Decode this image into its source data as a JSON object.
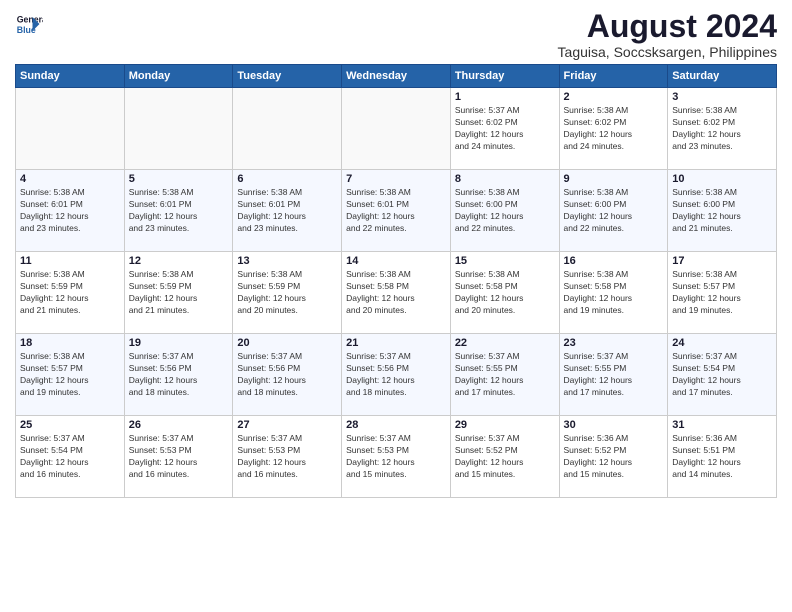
{
  "logo": {
    "line1": "General",
    "line2": "Blue"
  },
  "title": "August 2024",
  "location": "Taguisa, Soccsksargen, Philippines",
  "days_of_week": [
    "Sunday",
    "Monday",
    "Tuesday",
    "Wednesday",
    "Thursday",
    "Friday",
    "Saturday"
  ],
  "weeks": [
    [
      {
        "day": "",
        "info": ""
      },
      {
        "day": "",
        "info": ""
      },
      {
        "day": "",
        "info": ""
      },
      {
        "day": "",
        "info": ""
      },
      {
        "day": "1",
        "info": "Sunrise: 5:37 AM\nSunset: 6:02 PM\nDaylight: 12 hours\nand 24 minutes."
      },
      {
        "day": "2",
        "info": "Sunrise: 5:38 AM\nSunset: 6:02 PM\nDaylight: 12 hours\nand 24 minutes."
      },
      {
        "day": "3",
        "info": "Sunrise: 5:38 AM\nSunset: 6:02 PM\nDaylight: 12 hours\nand 23 minutes."
      }
    ],
    [
      {
        "day": "4",
        "info": "Sunrise: 5:38 AM\nSunset: 6:01 PM\nDaylight: 12 hours\nand 23 minutes."
      },
      {
        "day": "5",
        "info": "Sunrise: 5:38 AM\nSunset: 6:01 PM\nDaylight: 12 hours\nand 23 minutes."
      },
      {
        "day": "6",
        "info": "Sunrise: 5:38 AM\nSunset: 6:01 PM\nDaylight: 12 hours\nand 23 minutes."
      },
      {
        "day": "7",
        "info": "Sunrise: 5:38 AM\nSunset: 6:01 PM\nDaylight: 12 hours\nand 22 minutes."
      },
      {
        "day": "8",
        "info": "Sunrise: 5:38 AM\nSunset: 6:00 PM\nDaylight: 12 hours\nand 22 minutes."
      },
      {
        "day": "9",
        "info": "Sunrise: 5:38 AM\nSunset: 6:00 PM\nDaylight: 12 hours\nand 22 minutes."
      },
      {
        "day": "10",
        "info": "Sunrise: 5:38 AM\nSunset: 6:00 PM\nDaylight: 12 hours\nand 21 minutes."
      }
    ],
    [
      {
        "day": "11",
        "info": "Sunrise: 5:38 AM\nSunset: 5:59 PM\nDaylight: 12 hours\nand 21 minutes."
      },
      {
        "day": "12",
        "info": "Sunrise: 5:38 AM\nSunset: 5:59 PM\nDaylight: 12 hours\nand 21 minutes."
      },
      {
        "day": "13",
        "info": "Sunrise: 5:38 AM\nSunset: 5:59 PM\nDaylight: 12 hours\nand 20 minutes."
      },
      {
        "day": "14",
        "info": "Sunrise: 5:38 AM\nSunset: 5:58 PM\nDaylight: 12 hours\nand 20 minutes."
      },
      {
        "day": "15",
        "info": "Sunrise: 5:38 AM\nSunset: 5:58 PM\nDaylight: 12 hours\nand 20 minutes."
      },
      {
        "day": "16",
        "info": "Sunrise: 5:38 AM\nSunset: 5:58 PM\nDaylight: 12 hours\nand 19 minutes."
      },
      {
        "day": "17",
        "info": "Sunrise: 5:38 AM\nSunset: 5:57 PM\nDaylight: 12 hours\nand 19 minutes."
      }
    ],
    [
      {
        "day": "18",
        "info": "Sunrise: 5:38 AM\nSunset: 5:57 PM\nDaylight: 12 hours\nand 19 minutes."
      },
      {
        "day": "19",
        "info": "Sunrise: 5:37 AM\nSunset: 5:56 PM\nDaylight: 12 hours\nand 18 minutes."
      },
      {
        "day": "20",
        "info": "Sunrise: 5:37 AM\nSunset: 5:56 PM\nDaylight: 12 hours\nand 18 minutes."
      },
      {
        "day": "21",
        "info": "Sunrise: 5:37 AM\nSunset: 5:56 PM\nDaylight: 12 hours\nand 18 minutes."
      },
      {
        "day": "22",
        "info": "Sunrise: 5:37 AM\nSunset: 5:55 PM\nDaylight: 12 hours\nand 17 minutes."
      },
      {
        "day": "23",
        "info": "Sunrise: 5:37 AM\nSunset: 5:55 PM\nDaylight: 12 hours\nand 17 minutes."
      },
      {
        "day": "24",
        "info": "Sunrise: 5:37 AM\nSunset: 5:54 PM\nDaylight: 12 hours\nand 17 minutes."
      }
    ],
    [
      {
        "day": "25",
        "info": "Sunrise: 5:37 AM\nSunset: 5:54 PM\nDaylight: 12 hours\nand 16 minutes."
      },
      {
        "day": "26",
        "info": "Sunrise: 5:37 AM\nSunset: 5:53 PM\nDaylight: 12 hours\nand 16 minutes."
      },
      {
        "day": "27",
        "info": "Sunrise: 5:37 AM\nSunset: 5:53 PM\nDaylight: 12 hours\nand 16 minutes."
      },
      {
        "day": "28",
        "info": "Sunrise: 5:37 AM\nSunset: 5:53 PM\nDaylight: 12 hours\nand 15 minutes."
      },
      {
        "day": "29",
        "info": "Sunrise: 5:37 AM\nSunset: 5:52 PM\nDaylight: 12 hours\nand 15 minutes."
      },
      {
        "day": "30",
        "info": "Sunrise: 5:36 AM\nSunset: 5:52 PM\nDaylight: 12 hours\nand 15 minutes."
      },
      {
        "day": "31",
        "info": "Sunrise: 5:36 AM\nSunset: 5:51 PM\nDaylight: 12 hours\nand 14 minutes."
      }
    ]
  ]
}
